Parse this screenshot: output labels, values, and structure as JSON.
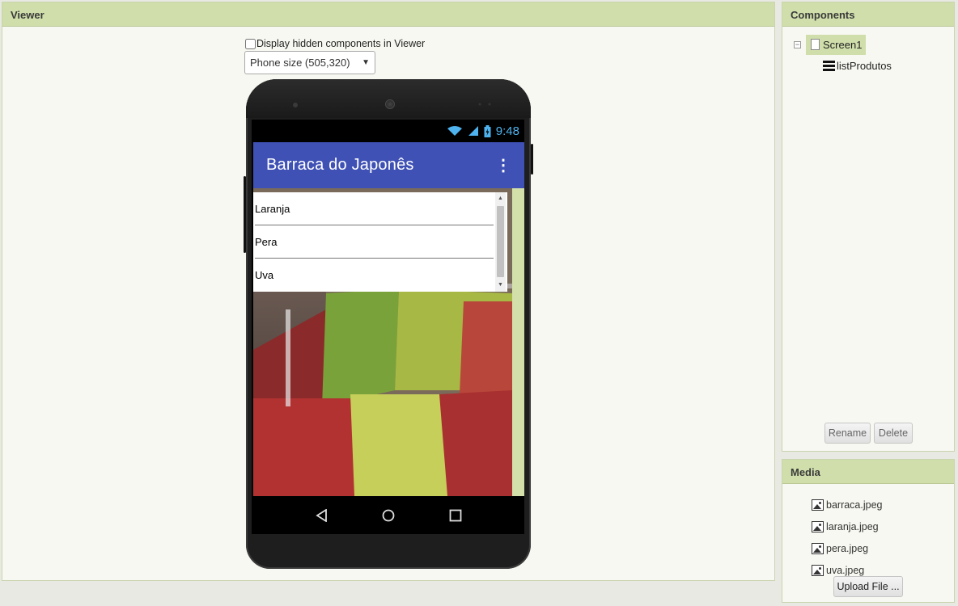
{
  "viewer": {
    "header": "Viewer",
    "hidden_label": "Display hidden components in Viewer",
    "phone_size": "Phone size (505,320)"
  },
  "phone": {
    "time": "9:48",
    "app_title": "Barraca do Japonês",
    "list_items": [
      "Laranja",
      "Pera",
      "Uva"
    ]
  },
  "components": {
    "header": "Components",
    "screen": "Screen1",
    "children": [
      "listProdutos"
    ],
    "rename_label": "Rename",
    "delete_label": "Delete"
  },
  "media": {
    "header": "Media",
    "files": [
      "barraca.jpeg",
      "laranja.jpeg",
      "pera.jpeg",
      "uva.jpeg"
    ],
    "upload_label": "Upload File ..."
  },
  "colors": {
    "panel_header": "#cfdeaa",
    "appbar": "#3f51b5",
    "statusbar_text": "#4fb3f0"
  }
}
